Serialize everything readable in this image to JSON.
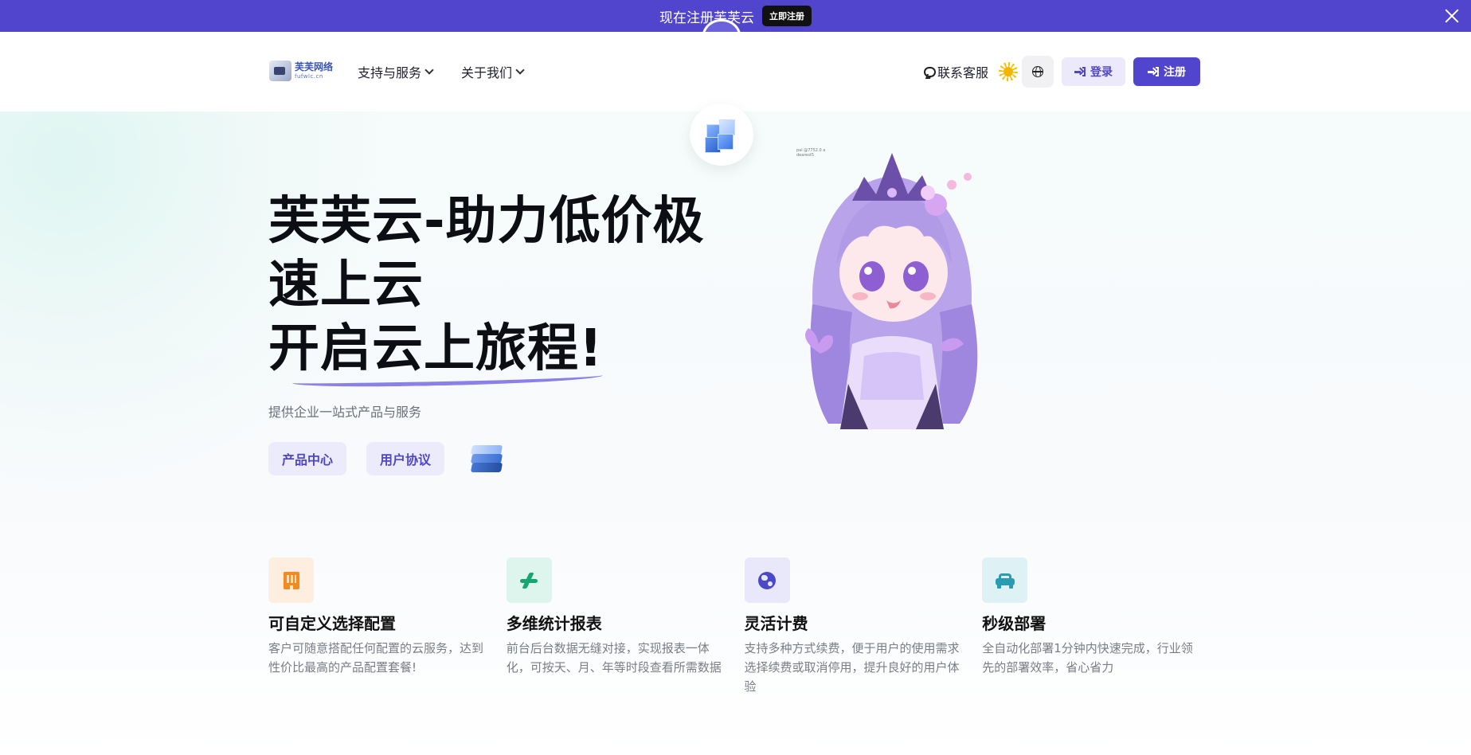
{
  "promo": {
    "text": "现在注册芙芙云",
    "button": "立即注册"
  },
  "header": {
    "logo_title": "芙芙网络",
    "logo_sub": "fufwlc.cn",
    "nav": [
      {
        "label": "支持与服务"
      },
      {
        "label": "关于我们"
      }
    ],
    "contact": "联系客服",
    "login": "登录",
    "register": "注册"
  },
  "hero": {
    "title_line1": "芙芙云-助力低价极",
    "title_line2": "速上云",
    "title_line3": "开启云上旅程!",
    "subtitle": "提供企业一站式产品与服务",
    "buttons": {
      "products": "产品中心",
      "agreement": "用户协议"
    },
    "mascot_note": "pai @7752.0 a dearest5"
  },
  "features": [
    {
      "icon": "building-icon",
      "bg": "#fdeee0",
      "title": "可自定义选择配置",
      "desc": "客户可随意搭配任何配置的云服务，达到性价比最高的产品配置套餐!"
    },
    {
      "icon": "plane-icon",
      "bg": "#def5ee",
      "title": "多维统计报表",
      "desc": "前台后台数据无缝对接，实现报表一体化，可按天、月、年等时段查看所需数据"
    },
    {
      "icon": "globe-icon",
      "bg": "#e9e8fb",
      "title": "灵活计费",
      "desc": "支持多种方式续费，便于用户的使用需求选择续费或取消停用，提升良好的用户体验"
    },
    {
      "icon": "car-icon",
      "bg": "#def2f5",
      "title": "秒级部署",
      "desc": "全自动化部署1分钟内快速完成，行业领先的部署效率，省心省力"
    }
  ],
  "colors": {
    "brand": "#5145cd",
    "brand_light": "#ecebfb"
  }
}
